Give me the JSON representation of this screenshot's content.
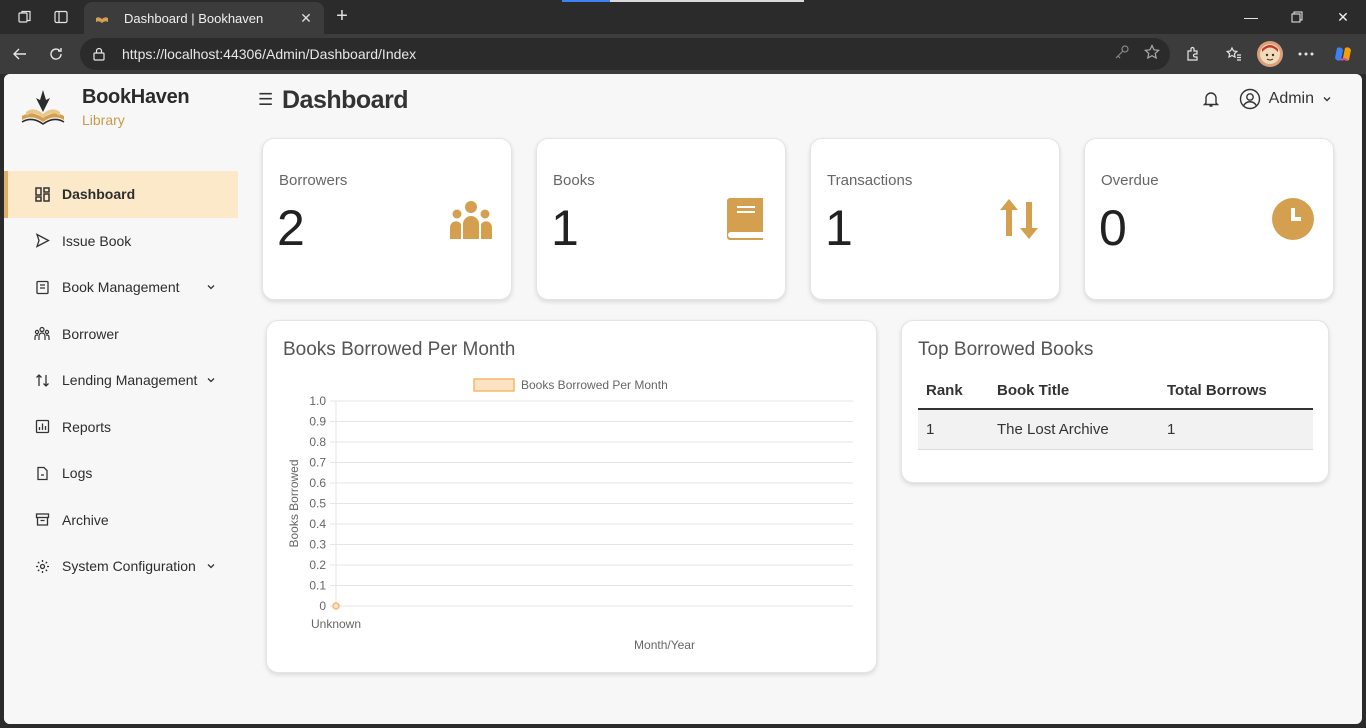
{
  "browser": {
    "tab_title": "Dashboard | Bookhaven",
    "url": "https://localhost:44306/Admin/Dashboard/Index"
  },
  "brand": {
    "name": "BookHaven",
    "subtitle": "Library"
  },
  "sidebar": {
    "items": [
      {
        "label": "Dashboard",
        "icon": "dashboard-icon",
        "active": true
      },
      {
        "label": "Issue Book",
        "icon": "send-icon"
      },
      {
        "label": "Book Management",
        "icon": "book-icon",
        "expandable": true
      },
      {
        "label": "Borrower",
        "icon": "people-icon"
      },
      {
        "label": "Lending Management",
        "icon": "swap-icon",
        "expandable": true
      },
      {
        "label": "Reports",
        "icon": "bar-chart-icon"
      },
      {
        "label": "Logs",
        "icon": "file-icon"
      },
      {
        "label": "Archive",
        "icon": "archive-icon"
      },
      {
        "label": "System Configuration",
        "icon": "gear-icon",
        "expandable": true
      }
    ]
  },
  "header": {
    "title": "Dashboard",
    "user_label": "Admin"
  },
  "stats": [
    {
      "label": "Borrowers",
      "value": "2",
      "icon": "people-icon"
    },
    {
      "label": "Books",
      "value": "1",
      "icon": "book-icon"
    },
    {
      "label": "Transactions",
      "value": "1",
      "icon": "arrows-up-down-icon"
    },
    {
      "label": "Overdue",
      "value": "0",
      "icon": "clock-icon"
    }
  ],
  "chart_card": {
    "title": "Books Borrowed Per Month"
  },
  "chart_data": {
    "type": "line",
    "categories": [
      "Unknown"
    ],
    "series": [
      {
        "name": "Books Borrowed Per Month",
        "values": [
          0
        ]
      }
    ],
    "xlabel": "Month/Year",
    "ylabel": "Books Borrowed",
    "ylim": [
      0,
      1.0
    ],
    "yticks": [
      "1.0",
      "0.9",
      "0.8",
      "0.7",
      "0.6",
      "0.5",
      "0.4",
      "0.3",
      "0.2",
      "0.1",
      "0"
    ],
    "grid": true,
    "legend": "top",
    "color": "#f5b86a"
  },
  "top_books": {
    "title": "Top Borrowed Books",
    "columns": [
      "Rank",
      "Book Title",
      "Total Borrows"
    ],
    "rows": [
      [
        "1",
        "The Lost Archive",
        "1"
      ]
    ]
  },
  "colors": {
    "accent": "#d4a050",
    "active_bg": "#fbe9c9"
  }
}
